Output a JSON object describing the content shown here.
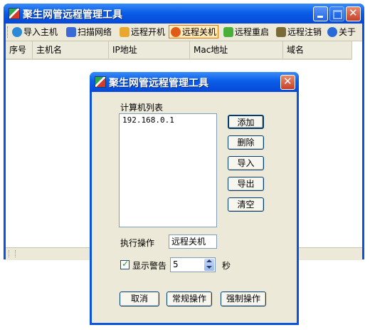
{
  "main": {
    "title": "聚生网管远程管理工具",
    "toolbar": [
      {
        "label": "导入主机",
        "icon": "globe-icon",
        "color": "#2a8ad8"
      },
      {
        "label": "扫描网络",
        "icon": "network-scan-icon",
        "color": "#3a6ad8"
      },
      {
        "label": "远程开机",
        "icon": "power-on-icon",
        "color": "#e8a830"
      },
      {
        "label": "远程关机",
        "icon": "power-off-icon",
        "color": "#e05a18",
        "active": true
      },
      {
        "label": "远程重启",
        "icon": "restart-icon",
        "color": "#48b038"
      },
      {
        "label": "远程注销",
        "icon": "logoff-icon",
        "color": "#7a6a38"
      },
      {
        "label": "关于",
        "icon": "info-icon",
        "color": "#2a6ad8"
      }
    ],
    "columns": [
      "序号",
      "主机名",
      "IP地址",
      "Mac地址",
      "域名"
    ]
  },
  "dialog": {
    "title": "聚生网管远程管理工具",
    "list_label": "计算机列表",
    "computers": [
      "192.168.0.1"
    ],
    "buttons": {
      "add": "添加",
      "delete": "删除",
      "import": "导入",
      "export": "导出",
      "clear": "清空"
    },
    "operation_label": "执行操作",
    "operation_value": "远程关机",
    "show_warning_label": "显示警告",
    "show_warning_checked": true,
    "warning_seconds": "5",
    "seconds_unit": "秒",
    "footer": {
      "cancel": "取消",
      "normal": "常规操作",
      "force": "强制操作"
    }
  }
}
